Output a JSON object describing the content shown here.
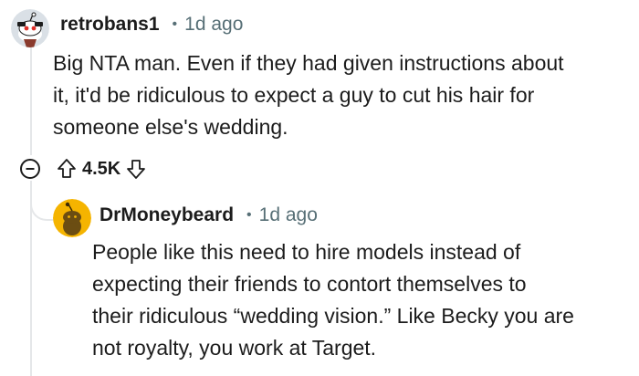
{
  "comments": [
    {
      "username": "retrobans1",
      "separator": "•",
      "time": "1d ago",
      "lines": [
        "Big NTA man. Even if they had given instructions about",
        "it, it'd be ridiculous to expect a guy to cut his hair for",
        "someone else's wedding."
      ],
      "score": "4.5K",
      "avatar_icon": "snoo-avatar-icon"
    },
    {
      "username": "DrMoneybeard",
      "separator": "•",
      "time": "1d ago",
      "lines": [
        "People like this need to hire models instead of",
        "expecting their friends to contort themselves to",
        "their ridiculous “wedding vision.” Like Becky you are",
        "not royalty, you work at Target."
      ],
      "avatar_icon": "snoo-avatar-icon"
    }
  ],
  "colors": {
    "text": "#1c1c1c",
    "meta": "#576f76",
    "thread_line": "#e5e7e9",
    "avatar2_bg": "#f5b400"
  }
}
